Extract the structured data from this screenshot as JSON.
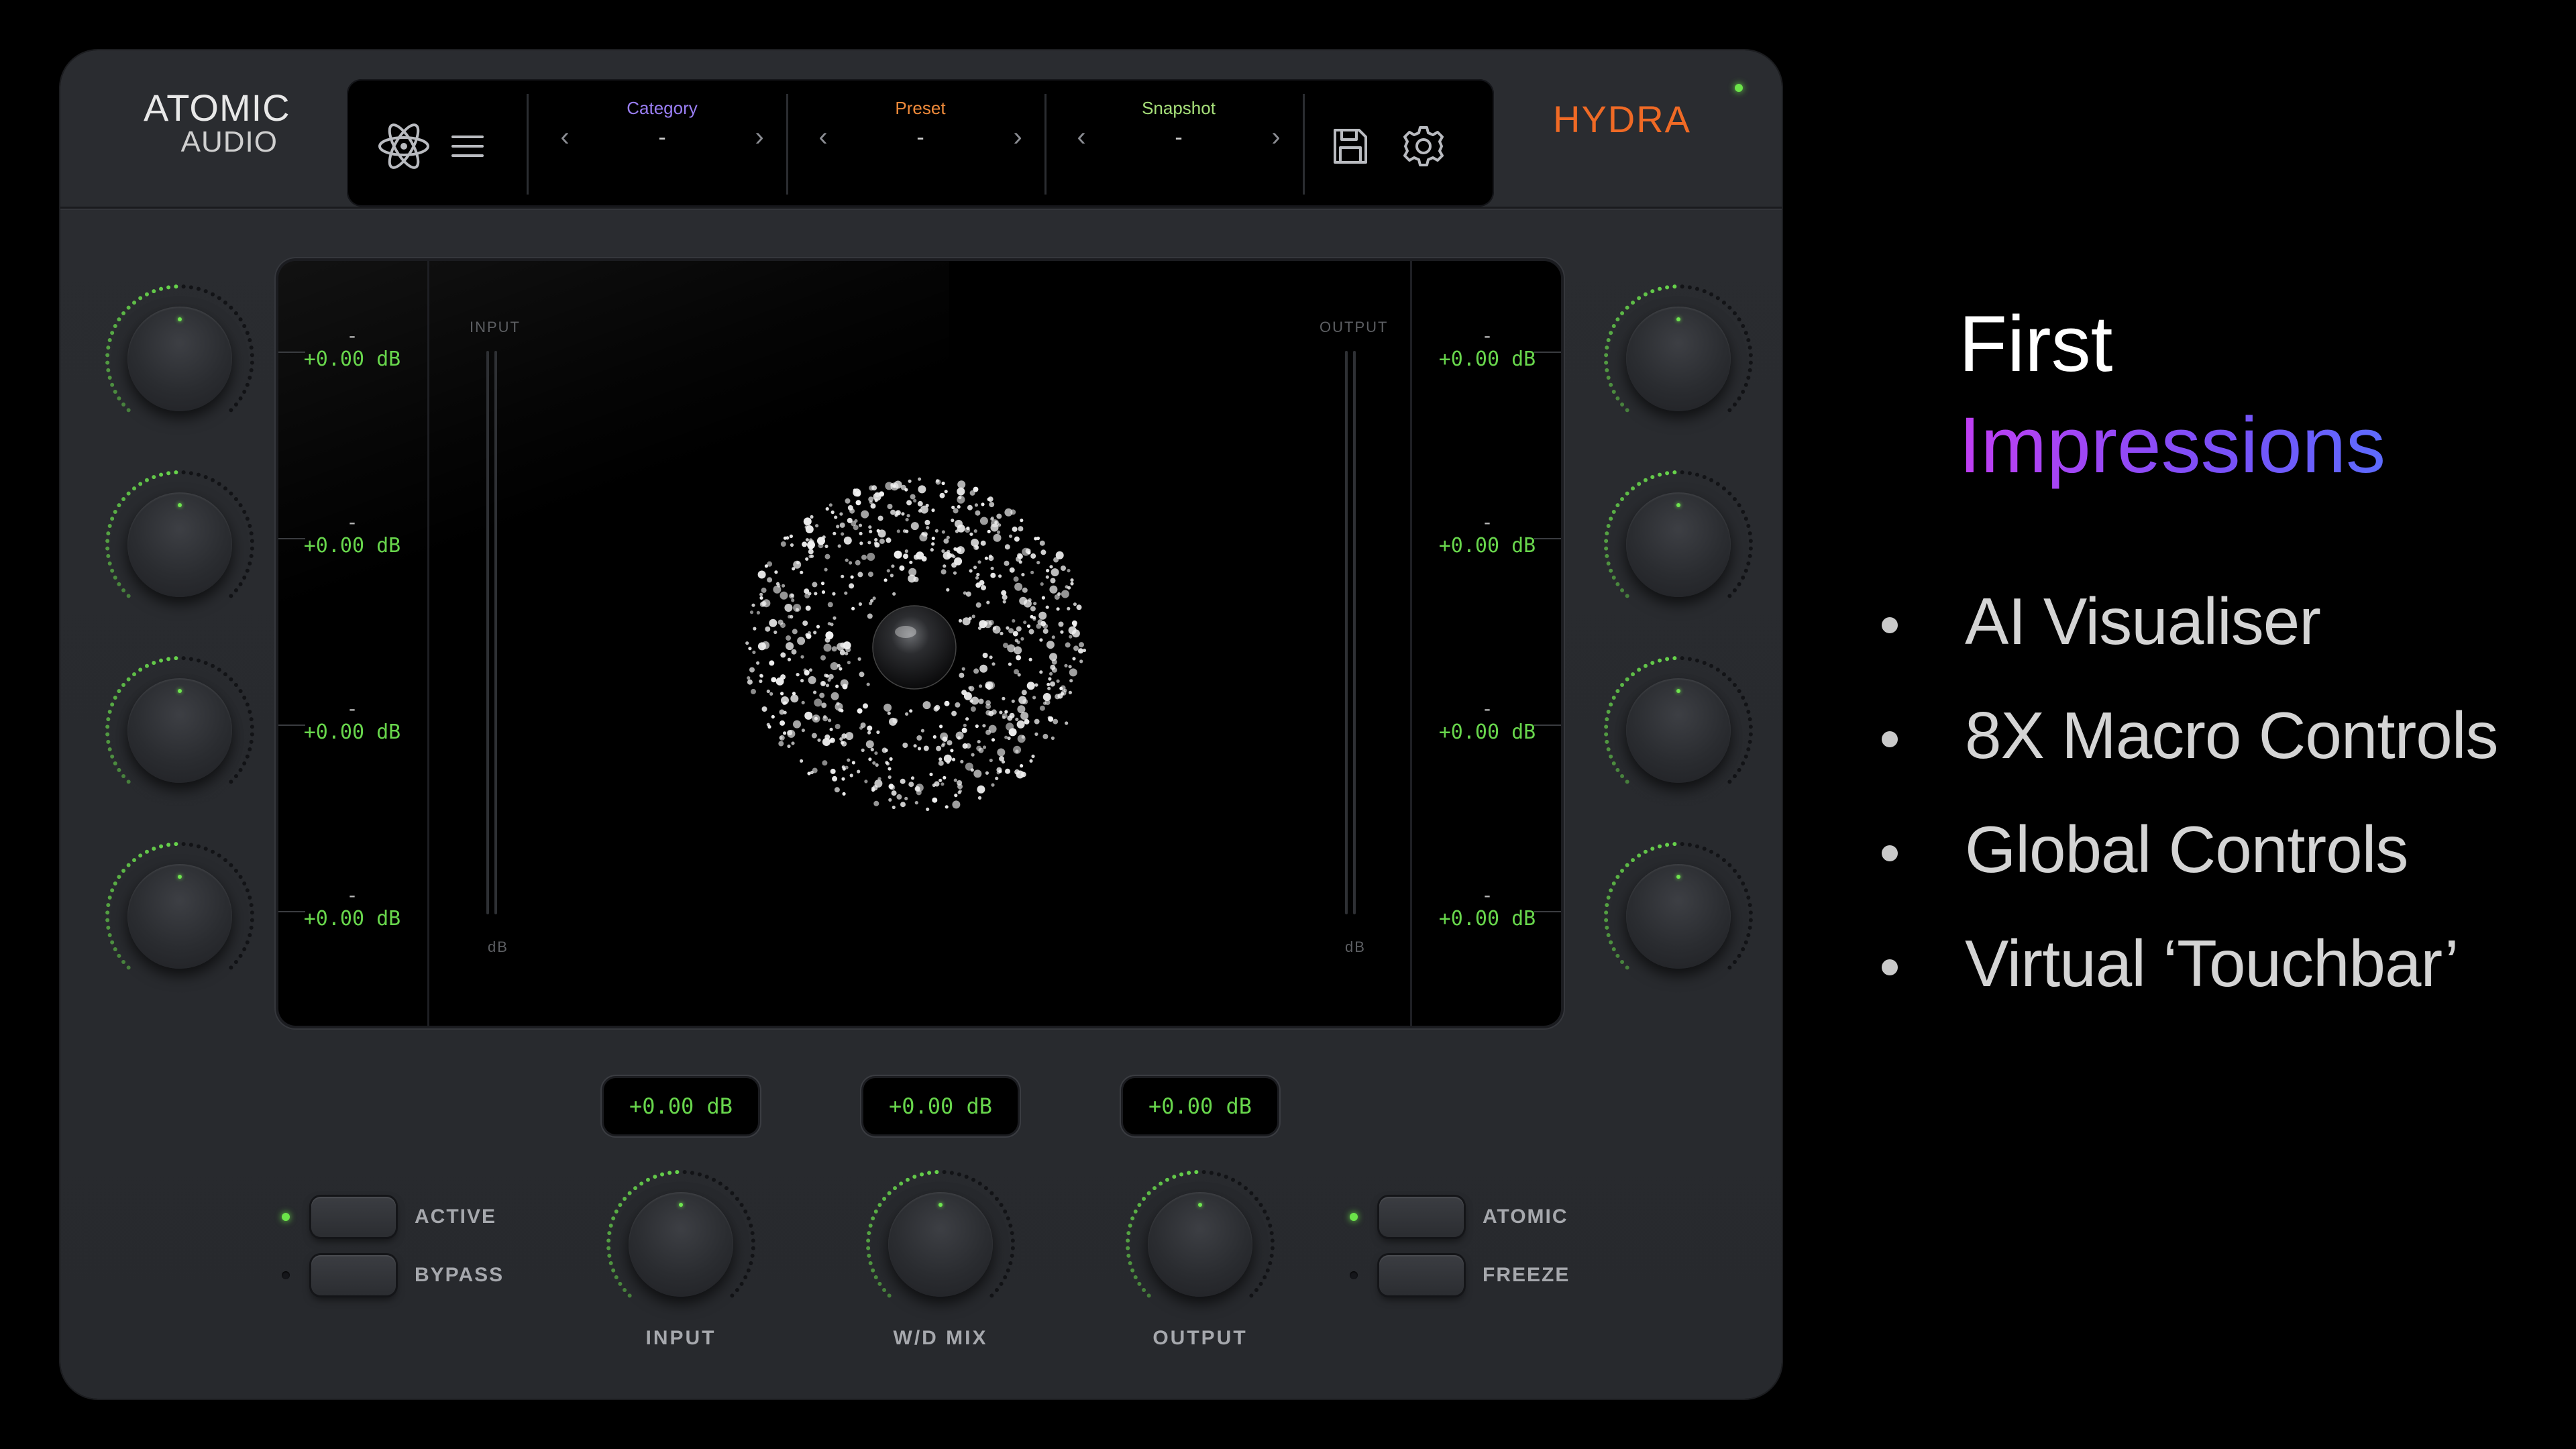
{
  "plugin": {
    "brand": {
      "line1": "ATOMIC",
      "line2": "AUDIO"
    },
    "product_name": "HYDRA",
    "nav": {
      "icons": [
        "atom-icon",
        "menu-icon",
        "save-icon",
        "settings-icon"
      ],
      "selectors": [
        {
          "label": "Category",
          "value": "-",
          "label_color": "#9b7ff5"
        },
        {
          "label": "Preset",
          "value": "-",
          "label_color": "#ef8a3a"
        },
        {
          "label": "Snapshot",
          "value": "-",
          "label_color": "#a7e07a"
        }
      ],
      "prev_glyph": "‹",
      "next_glyph": "›"
    },
    "display": {
      "input_label": "INPUT",
      "output_label": "OUTPUT",
      "unit_label": "dB",
      "left_readouts": [
        {
          "name": "-",
          "value": "+0.00 dB"
        },
        {
          "name": "-",
          "value": "+0.00 dB"
        },
        {
          "name": "-",
          "value": "+0.00 dB"
        },
        {
          "name": "-",
          "value": "+0.00 dB"
        }
      ],
      "right_readouts": [
        {
          "name": "-",
          "value": "+0.00 dB"
        },
        {
          "name": "-",
          "value": "+0.00 dB"
        },
        {
          "name": "-",
          "value": "+0.00 dB"
        },
        {
          "name": "-",
          "value": "+0.00 dB"
        }
      ]
    },
    "global_controls": {
      "readouts": [
        "+0.00 dB",
        "+0.00 dB",
        "+0.00 dB"
      ],
      "knob_labels": [
        "INPUT",
        "W/D MIX",
        "OUTPUT"
      ]
    },
    "toggles_left": [
      {
        "label": "ACTIVE",
        "on": true
      },
      {
        "label": "BYPASS",
        "on": false
      }
    ],
    "toggles_right": [
      {
        "label": "ATOMIC",
        "on": true
      },
      {
        "label": "FREEZE",
        "on": false
      }
    ],
    "accent_green": "#68d64c",
    "accent_orange": "#f06a25"
  },
  "slide": {
    "title_line1": "First",
    "title_line2": "Impressions",
    "bullets": [
      "AI Visualiser",
      "8X Macro Controls",
      "Global Controls",
      "Virtual ‘Touchbar’"
    ]
  }
}
